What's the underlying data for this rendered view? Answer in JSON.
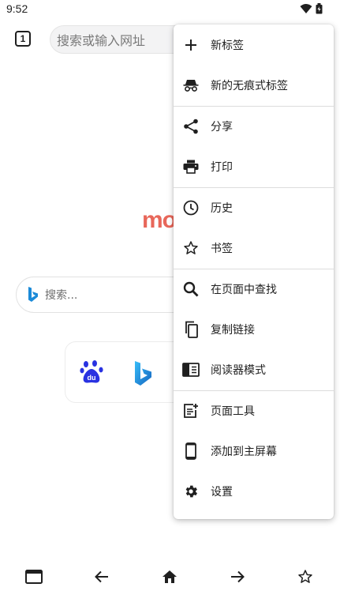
{
  "status_bar": {
    "time": "9:52",
    "icons": [
      "wifi-icon",
      "battery-icon"
    ]
  },
  "toolbar": {
    "tab_count": "1",
    "url_placeholder": "搜索或输入网址"
  },
  "homepage": {
    "logo_text": "mo",
    "search_placeholder": "搜索...",
    "shortcuts": [
      "baidu-icon",
      "bing-icon"
    ]
  },
  "menu": {
    "items": [
      {
        "label": "新标签",
        "icon": "plus-icon"
      },
      {
        "label": "新的无痕式标签",
        "icon": "incognito-icon"
      },
      {
        "label": "分享",
        "icon": "share-icon"
      },
      {
        "label": "打印",
        "icon": "print-icon"
      },
      {
        "label": "历史",
        "icon": "clock-icon"
      },
      {
        "label": "书签",
        "icon": "star-icon"
      },
      {
        "label": "在页面中查找",
        "icon": "search-icon"
      },
      {
        "label": "复制链接",
        "icon": "copy-icon"
      },
      {
        "label": "阅读器模式",
        "icon": "reader-mode-icon"
      },
      {
        "label": "页面工具",
        "icon": "page-tools-icon"
      },
      {
        "label": "添加到主屏幕",
        "icon": "phone-icon"
      },
      {
        "label": "设置",
        "icon": "gear-icon"
      }
    ]
  },
  "bottom_bar": [
    "tabs-icon",
    "back-arrow-icon",
    "home-icon",
    "forward-arrow-icon",
    "bookmark-star-icon"
  ],
  "colors": {
    "logo": "#e8675a",
    "bing": "#1a8ad8",
    "baidu": "#2932e1"
  }
}
